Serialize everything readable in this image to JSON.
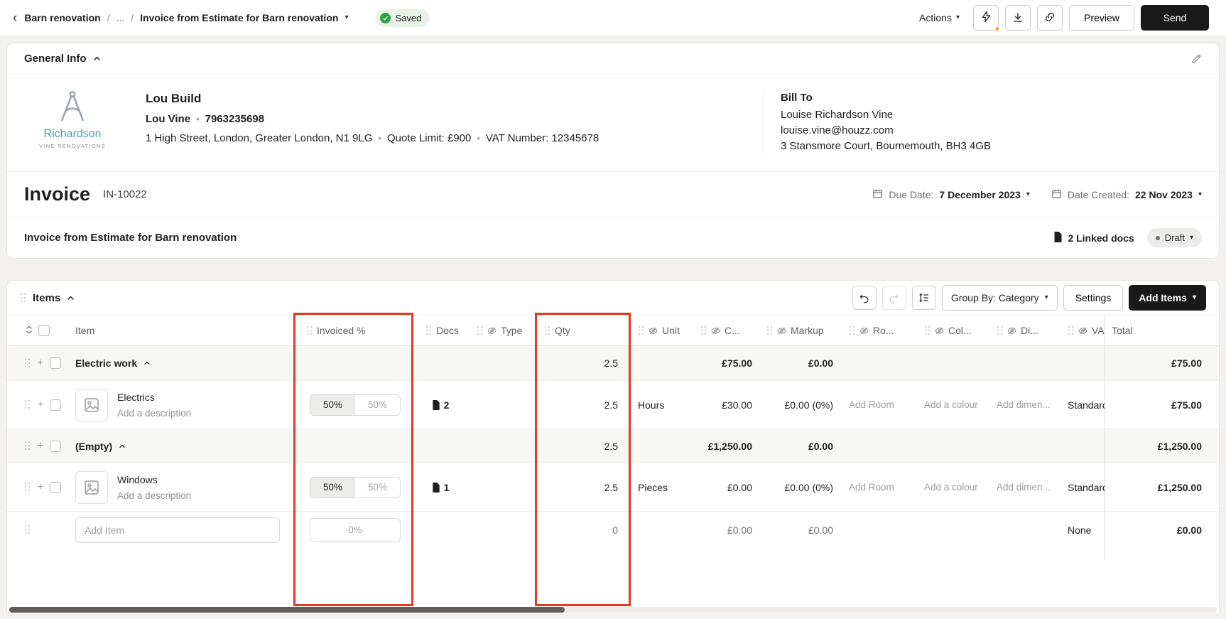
{
  "glyphs": {
    "caret_down": "▾",
    "chevron_left": "‹",
    "plus": "+",
    "dot": "•"
  },
  "colors": {
    "highlight_red": "#e23a1e",
    "send_black": "#191919",
    "saved_green": "#2f9e44",
    "brand_teal": "#49a69b"
  },
  "topbar": {
    "project": "Barn renovation",
    "sep1": "/",
    "ellipsis": "...",
    "sep2": "/",
    "current": "Invoice from Estimate for Barn renovation",
    "saved": "Saved",
    "actions": "Actions",
    "preview": "Preview",
    "send": "Send"
  },
  "general": {
    "title": "General Info",
    "logo_line1": "Richardson",
    "logo_line2": "Vine Renovations",
    "company_name": "Lou Build",
    "contact_name": "Lou Vine",
    "phone": "7963235698",
    "address": "1 High Street, London, Greater London, N1 9LG",
    "quote_limit": "Quote Limit: £900",
    "vat_number": "VAT Number: 12345678",
    "bill_to": {
      "heading": "Bill To",
      "name": "Louise Richardson Vine",
      "email": "louise.vine@houzz.com",
      "address": "3 Stansmore Court, Bournemouth, BH3 4GB"
    }
  },
  "invoice": {
    "heading": "Invoice",
    "number": "IN-10022",
    "due_label": "Due Date:",
    "due_value": "7 December 2023",
    "created_label": "Date Created:",
    "created_value": "22 Nov 2023",
    "name": "Invoice from Estimate for Barn renovation",
    "linked_docs": "2 Linked docs",
    "status": "Draft"
  },
  "items": {
    "title": "Items",
    "group_by": "Group By: Category",
    "settings": "Settings",
    "add_items": "Add Items",
    "columns": {
      "item": "Item",
      "invoiced": "Invoiced %",
      "docs": "Docs",
      "type": "Type",
      "qty": "Qty",
      "unit": "Unit",
      "cost": "C...",
      "markup": "Markup",
      "room": "Ro...",
      "colour": "Col...",
      "dims": "Di...",
      "vat": "VA",
      "total": "Total"
    },
    "rows": [
      {
        "kind": "category",
        "name": "Electric work",
        "qty": "2.5",
        "cost": "£75.00",
        "markup": "£0.00",
        "total": "£75.00"
      },
      {
        "kind": "item",
        "name": "Electrics",
        "desc": "Add a description",
        "pct_left": "50%",
        "pct_right": "50%",
        "docs": "2",
        "qty": "2.5",
        "unit": "Hours",
        "cost": "£30.00",
        "markup": "£0.00 (0%)",
        "room": "Add Room",
        "colour": "Add a colour",
        "dims": "Add dimen...",
        "vat": "Standard",
        "total": "£75.00"
      },
      {
        "kind": "category",
        "name": "(Empty)",
        "qty": "2.5",
        "cost": "£1,250.00",
        "markup": "£0.00",
        "total": "£1,250.00"
      },
      {
        "kind": "item",
        "name": "Windows",
        "desc": "Add a description",
        "pct_left": "50%",
        "pct_right": "50%",
        "docs": "1",
        "qty": "2.5",
        "unit": "Pieces",
        "cost": "£0.00",
        "markup": "£0.00 (0%)",
        "room": "Add Room",
        "colour": "Add a colour",
        "dims": "Add dimen...",
        "vat": "Standard",
        "total": "£1,250.00"
      }
    ],
    "add_row": {
      "placeholder": "Add Item",
      "invoiced": "0%",
      "qty": "0",
      "cost": "£0.00",
      "markup": "£0.00",
      "vat": "None",
      "total": "£0.00"
    }
  }
}
